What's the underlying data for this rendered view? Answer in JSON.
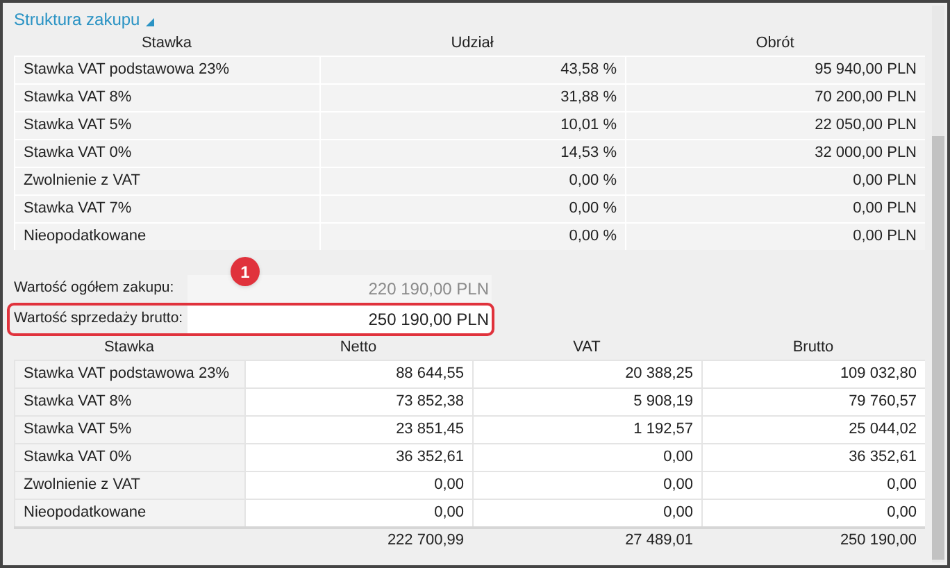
{
  "section_title": "Struktura zakupu",
  "purchase_table": {
    "columns": [
      "Stawka",
      "Udział",
      "Obrót"
    ],
    "rows": [
      [
        "Stawka VAT podstawowa 23%",
        "43,58 %",
        "95 940,00 PLN"
      ],
      [
        "Stawka VAT 8%",
        "31,88 %",
        "70 200,00 PLN"
      ],
      [
        "Stawka VAT 5%",
        "10,01 %",
        "22 050,00 PLN"
      ],
      [
        "Stawka VAT 0%",
        "14,53 %",
        "32 000,00 PLN"
      ],
      [
        "Zwolnienie z VAT",
        "0,00 %",
        "0,00 PLN"
      ],
      [
        "Stawka VAT 7%",
        "0,00 %",
        "0,00 PLN"
      ],
      [
        "Nieopodatkowane",
        "0,00 %",
        "0,00 PLN"
      ]
    ]
  },
  "fields": [
    {
      "label": "Wartość ogółem zakupu:",
      "value": "220 190,00 PLN",
      "disabled": true,
      "highlighted": false
    },
    {
      "label": "Wartość sprzedaży brutto:",
      "value": "250 190,00 PLN",
      "disabled": false,
      "highlighted": true
    }
  ],
  "callout_badge": "1",
  "sales_table": {
    "columns": [
      "Stawka",
      "Netto",
      "VAT",
      "Brutto"
    ],
    "rows": [
      [
        "Stawka VAT podstawowa 23%",
        "88 644,55",
        "20 388,25",
        "109 032,80"
      ],
      [
        "Stawka VAT 8%",
        "73 852,38",
        "5 908,19",
        "79 760,57"
      ],
      [
        "Stawka VAT 5%",
        "23 851,45",
        "1 192,57",
        "25 044,02"
      ],
      [
        "Stawka VAT 0%",
        "36 352,61",
        "0,00",
        "36 352,61"
      ],
      [
        "Zwolnienie z VAT",
        "0,00",
        "0,00",
        "0,00"
      ],
      [
        "Nieopodatkowane",
        "0,00",
        "0,00",
        "0,00"
      ]
    ],
    "totals": [
      "222 700,99",
      "27 489,01",
      "250 190,00"
    ]
  }
}
